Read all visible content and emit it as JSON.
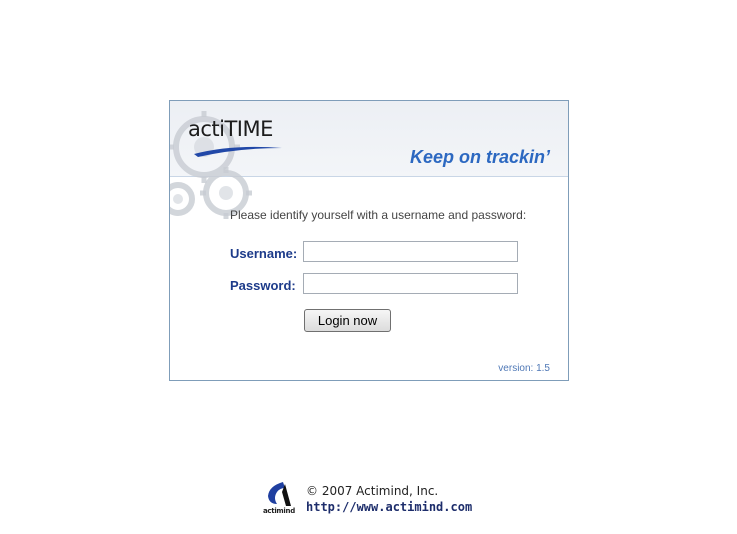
{
  "header": {
    "logo_text": "actiTIME",
    "tagline": "Keep on trackin’"
  },
  "form": {
    "instructions": "Please identify yourself with a username and password:",
    "username_label": "Username:",
    "username_value": "",
    "password_label": "Password:",
    "password_value": "",
    "login_button": "Login now"
  },
  "version_text": "version: 1.5",
  "footer": {
    "company_logo_label": "actimind",
    "copyright": "© 2007 Actimind, Inc.",
    "link": "http://www.actimind.com"
  },
  "colors": {
    "accent": "#2c68c1",
    "label": "#1d3b8a",
    "border": "#7f9db9"
  },
  "icons": [
    "gears-decoration",
    "actitime-logo",
    "actimind-logo-icon"
  ]
}
